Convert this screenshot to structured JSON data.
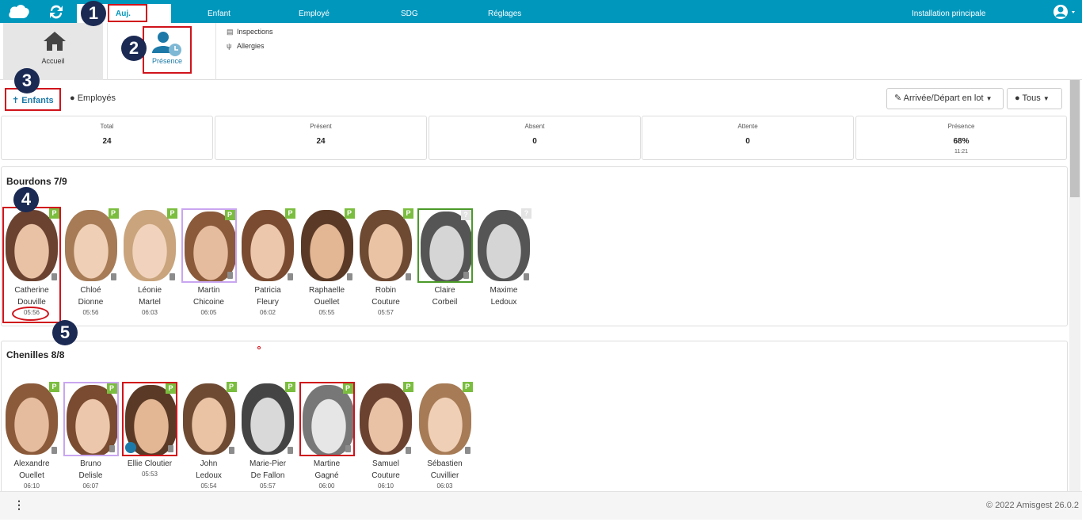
{
  "topbar": {
    "tabs": [
      {
        "label": "Auj."
      },
      {
        "label": "Enfant"
      },
      {
        "label": "Employé"
      },
      {
        "label": "SDG"
      },
      {
        "label": "Réglages"
      }
    ],
    "installation": "Installation principale",
    "accent_color": "#0097bd"
  },
  "badges": [
    "1",
    "2",
    "3",
    "4",
    "5"
  ],
  "subbar": {
    "home_label": "Accueil",
    "presence_label": "Présence",
    "links": [
      {
        "label": "Inspections",
        "icon": "clipboard-icon"
      },
      {
        "label": "Allergies",
        "icon": "utensils-icon"
      }
    ]
  },
  "filters": {
    "enfants": "Enfants",
    "employes": "Employés",
    "bulk_button": "Arrivée/Départ en lot",
    "all_button": "Tous"
  },
  "stats": [
    {
      "title": "Total",
      "value": "24",
      "sub": ""
    },
    {
      "title": "Présent",
      "value": "24",
      "sub": ""
    },
    {
      "title": "Absent",
      "value": "0",
      "sub": ""
    },
    {
      "title": "Attente",
      "value": "0",
      "sub": ""
    },
    {
      "title": "Présence",
      "value": "68%",
      "sub": "11:21"
    }
  ],
  "groups": [
    {
      "title": "Bourdons 7/9",
      "children": [
        {
          "first": "Catherine",
          "last": "Douville",
          "time": "05:56",
          "tag": "P",
          "border": "none"
        },
        {
          "first": "Chloé",
          "last": "Dionne",
          "time": "05:56",
          "tag": "P",
          "border": "none"
        },
        {
          "first": "Léonie",
          "last": "Martel",
          "time": "06:03",
          "tag": "P",
          "border": "none"
        },
        {
          "first": "Martin",
          "last": "Chicoine",
          "time": "06:05",
          "tag": "P",
          "border": "purple"
        },
        {
          "first": "Patricia",
          "last": "Fleury",
          "time": "06:02",
          "tag": "P",
          "border": "none"
        },
        {
          "first": "Raphaelle",
          "last": "Ouellet",
          "time": "05:55",
          "tag": "P",
          "border": "none"
        },
        {
          "first": "Robin",
          "last": "Couture",
          "time": "05:57",
          "tag": "P",
          "border": "none"
        },
        {
          "first": "Claire",
          "last": "Corbeil",
          "time": "",
          "tag": "?",
          "border": "green"
        },
        {
          "first": "Maxime",
          "last": "Ledoux",
          "time": "",
          "tag": "?",
          "border": "none"
        }
      ]
    },
    {
      "title": "Chenilles 8/8",
      "children": [
        {
          "first": "Alexandre",
          "last": "Ouellet",
          "time": "06:10",
          "tag": "P",
          "border": "none"
        },
        {
          "first": "Bruno",
          "last": "Delisle",
          "time": "06:07",
          "tag": "P",
          "border": "purple"
        },
        {
          "first": "Ellie Cloutier",
          "last": "",
          "time": "05:53",
          "tag": "P",
          "border": "red"
        },
        {
          "first": "John",
          "last": "Ledoux",
          "time": "05:54",
          "tag": "P",
          "border": "none"
        },
        {
          "first": "Marie-Pier",
          "last": "De Fallon",
          "time": "05:57",
          "tag": "P",
          "border": "none"
        },
        {
          "first": "Martine",
          "last": "Gagné",
          "time": "06:00",
          "tag": "P",
          "border": "red"
        },
        {
          "first": "Samuel",
          "last": "Couture",
          "time": "06:10",
          "tag": "P",
          "border": "none"
        },
        {
          "first": "Sébastien",
          "last": "Cuvillier",
          "time": "06:03",
          "tag": "P",
          "border": "none"
        }
      ]
    }
  ],
  "footer": {
    "menu": "⋮",
    "copyright": "© 2022 Amisgest 26.0.2"
  }
}
